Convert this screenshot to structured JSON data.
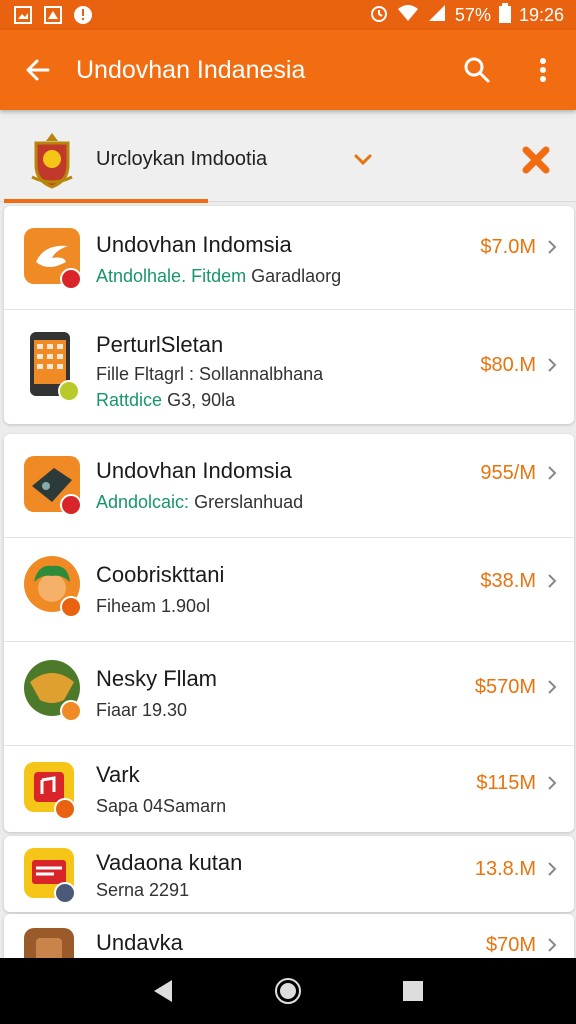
{
  "status_bar": {
    "time": "19:26",
    "battery": "57%"
  },
  "app_bar": {
    "title": "Undovhan Indanesia"
  },
  "filter": {
    "label": "Urcloykan Imdootia"
  },
  "list": [
    {
      "title": "Undovhan Indomsia",
      "sub_green": "Atndolhale. Fitdem",
      "sub": "Garadlaorg",
      "price": "$7.0M",
      "icon_color": "#f08a24",
      "badge_color": "#d9252a"
    },
    {
      "title": "PerturlSletan",
      "sub": "Fille Fltagrl : Sollannalbhana",
      "sub2_green": "Rattdice",
      "sub2": "G3, 90la",
      "price": "$80.M",
      "icon_color": "#333333",
      "badge_color": "#b8c92a"
    },
    {
      "title": "Undovhan Indomsia",
      "sub_green": "Adndolcaic:",
      "sub": "Grerslanhuad",
      "price": "955/M",
      "icon_color": "#f08a24",
      "badge_color": "#d9252a"
    },
    {
      "title": "Coobriskttani",
      "sub": "Fiheam 1.90ol",
      "price": "$38.M",
      "icon_color": "#f08a24",
      "badge_color": "#e8620f"
    },
    {
      "title": "Nesky Fllam",
      "sub": "Fiaar 19.30",
      "price": "$570M",
      "icon_color": "#6b8e3a",
      "badge_color": "#f08a24"
    },
    {
      "title": "Vark",
      "sub": "Sapa 04Samarn",
      "price": "$115M",
      "icon_color": "#f5c518",
      "badge_color": "#e8620f"
    },
    {
      "title": "Vadaona kutan",
      "sub": "Serna 2291",
      "price": "13.8.M",
      "icon_color": "#f5c518",
      "badge_color": "#4a5a78"
    },
    {
      "title": "Undavka",
      "price": "$70M",
      "icon_color": "#9b5a2a"
    }
  ]
}
